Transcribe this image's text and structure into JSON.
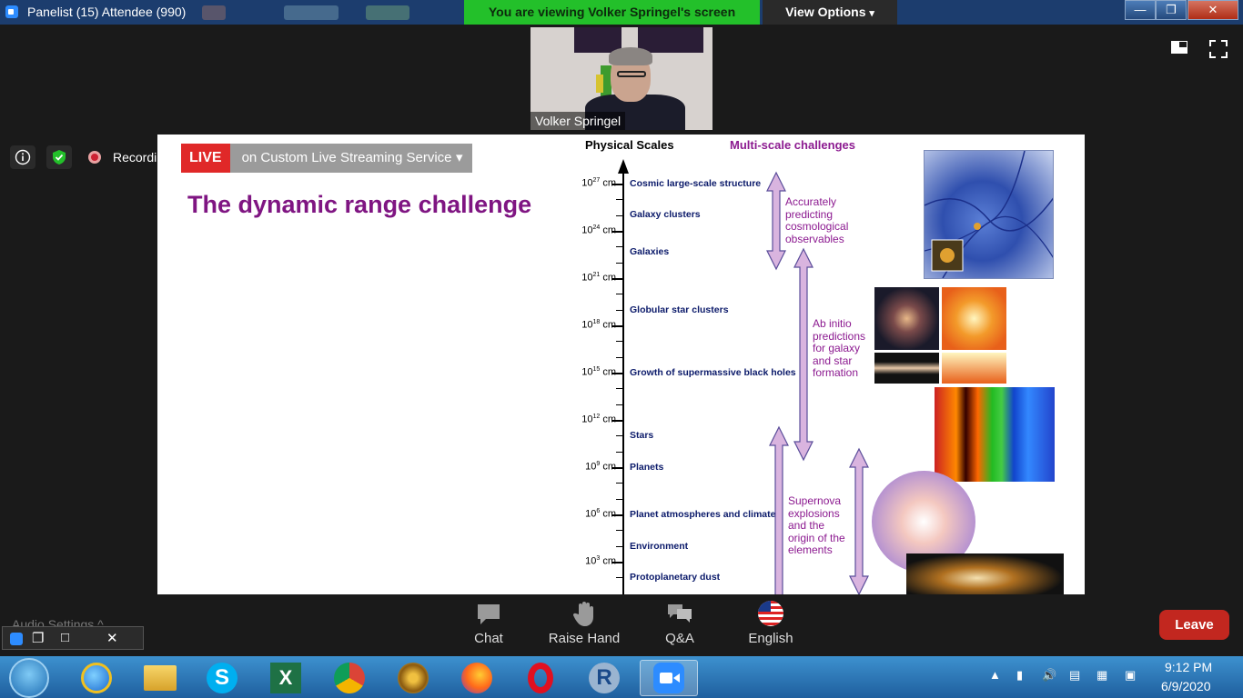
{
  "window": {
    "title": "Panelist (15) Attendee (990)",
    "viewing_banner": "You are viewing Volker Springel's screen",
    "view_options": "View Options",
    "minimize": "—",
    "restore": "❐",
    "close": "✕"
  },
  "speaker": {
    "name": "Volker Springel"
  },
  "status": {
    "recording": "Recording"
  },
  "live": {
    "tag": "LIVE",
    "service": "on Custom Live Streaming Service",
    "dropdown_arrow": "▾"
  },
  "slide": {
    "title": "The dynamic range challenge",
    "heading_scales": "Physical Scales",
    "heading_challenges": "Multi-scale challenges",
    "axis_unit": "cm",
    "ticks": [
      {
        "base": "10",
        "exp": "27",
        "unit": "cm"
      },
      {
        "base": "10",
        "exp": "24",
        "unit": "cm"
      },
      {
        "base": "10",
        "exp": "21",
        "unit": "cm"
      },
      {
        "base": "10",
        "exp": "18",
        "unit": "cm"
      },
      {
        "base": "10",
        "exp": "15",
        "unit": "cm"
      },
      {
        "base": "10",
        "exp": "12",
        "unit": "cm"
      },
      {
        "base": "10",
        "exp": "9",
        "unit": "cm"
      },
      {
        "base": "10",
        "exp": "6",
        "unit": "cm"
      },
      {
        "base": "10",
        "exp": "3",
        "unit": "cm"
      }
    ],
    "scales": [
      "Cosmic large-scale structure",
      "Galaxy clusters",
      "Galaxies",
      "Globular star clusters",
      "Growth of supermassive black holes",
      "Stars",
      "Planets",
      "Planet atmospheres and climate",
      "Environment",
      "Protoplanetary dust"
    ],
    "challenges": [
      [
        "Accurately",
        "predicting",
        "cosmological",
        "observables"
      ],
      [
        "Ab initio",
        "predictions",
        "for galaxy",
        "and star",
        "formation"
      ],
      [
        "Supernova",
        "explosions",
        "and the",
        "origin of the",
        "elements"
      ]
    ]
  },
  "toolbar": {
    "chat": "Chat",
    "raise_hand": "Raise Hand",
    "qa": "Q&A",
    "language": "English",
    "leave": "Leave",
    "audio_settings": "Audio Settings ^"
  },
  "icons": {
    "info": "info-icon",
    "shield": "shield-icon",
    "record": "record-icon",
    "minimize_window": "minimize-window-icon",
    "fullscreen": "fullscreen-icon"
  },
  "taskbar": {
    "time": "9:12 PM",
    "date": "6/9/2020",
    "items": [
      "Internet Explorer",
      "File Explorer",
      "Skype",
      "Excel",
      "Chrome",
      "App",
      "Firefox",
      "Opera",
      "R",
      "Zoom"
    ]
  },
  "colors": {
    "banner_green": "#23c02a",
    "live_red": "#e02828",
    "leave_red": "#c2271f",
    "title_purple": "#7f1582"
  }
}
